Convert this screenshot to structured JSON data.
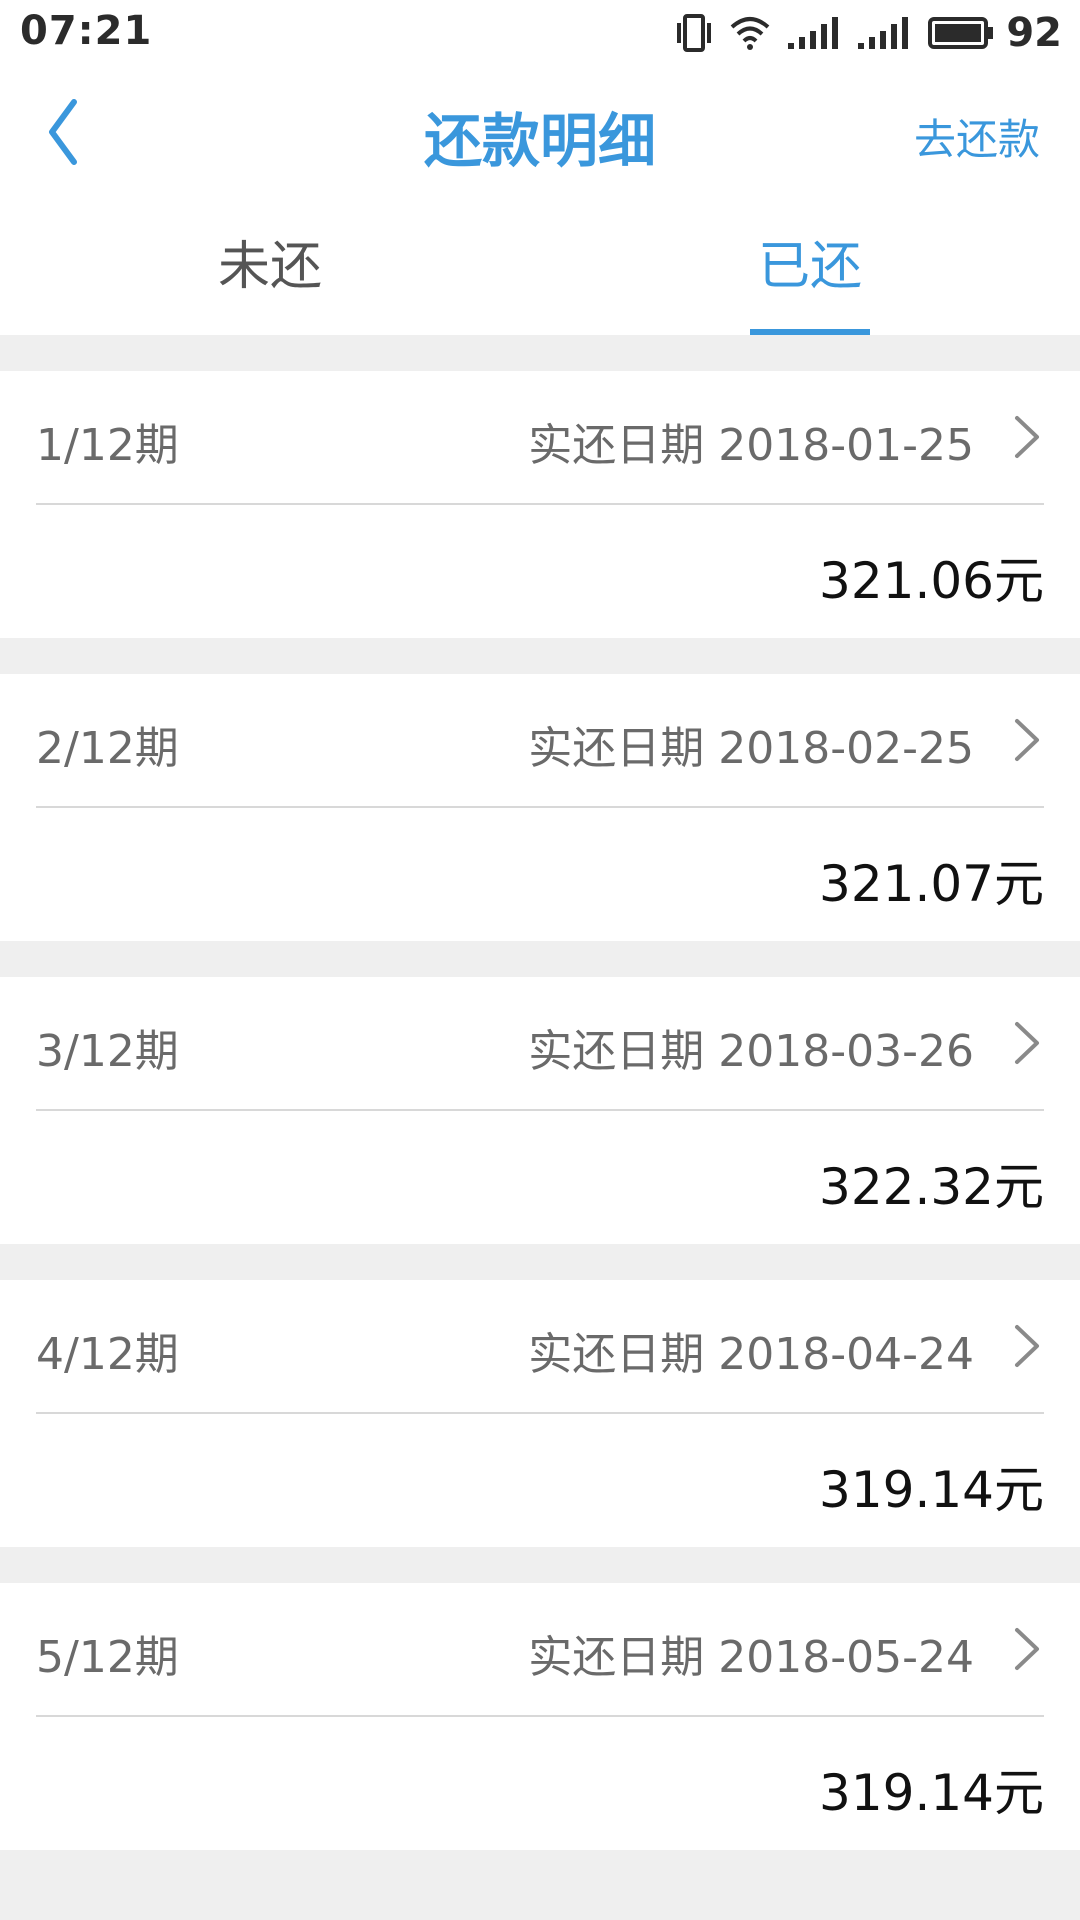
{
  "status_bar": {
    "time": "07:21",
    "battery": "92",
    "icons": [
      "vibrate-icon",
      "wifi-icon",
      "signal-icon",
      "signal-icon",
      "battery-icon"
    ]
  },
  "header": {
    "title": "还款明细",
    "action": "去还款",
    "back_icon": "chevron-left-icon"
  },
  "tabs": [
    {
      "label": "未还",
      "active": false
    },
    {
      "label": "已还",
      "active": true
    }
  ],
  "records": [
    {
      "period": "1/12期",
      "date_label": "实还日期",
      "date": "2018-01-25",
      "amount": "321.06元"
    },
    {
      "period": "2/12期",
      "date_label": "实还日期",
      "date": "2018-02-25",
      "amount": "321.07元"
    },
    {
      "period": "3/12期",
      "date_label": "实还日期",
      "date": "2018-03-26",
      "amount": "322.32元"
    },
    {
      "period": "4/12期",
      "date_label": "实还日期",
      "date": "2018-04-24",
      "amount": "319.14元"
    },
    {
      "period": "5/12期",
      "date_label": "实还日期",
      "date": "2018-05-24",
      "amount": "319.14元"
    }
  ],
  "colors": {
    "accent": "#3a97dc",
    "background": "#efefef",
    "card": "#ffffff",
    "muted_text": "#6a6a6a"
  }
}
